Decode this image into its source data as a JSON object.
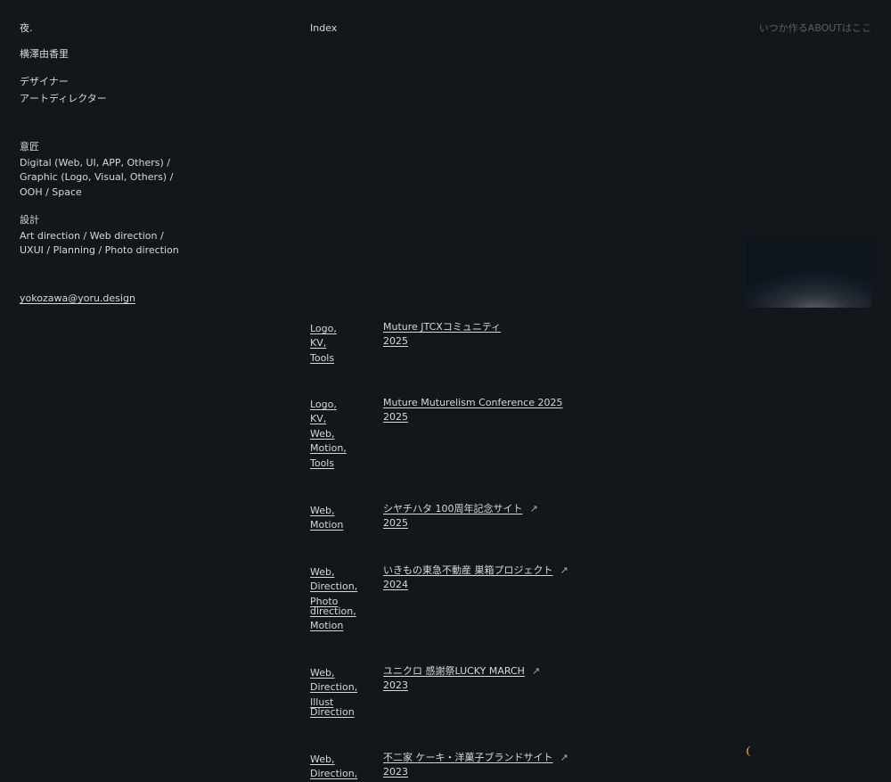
{
  "header": {
    "logo": "夜.",
    "index_label": "Index",
    "about_link": "いつか作るABOUTはここ"
  },
  "profile": {
    "name": "横澤由香里",
    "roles": [
      "デザイナー",
      "アートディレクター"
    ],
    "skills": [
      {
        "title": "意匠",
        "body": [
          "Digital (Web, UI, APP, Others) /",
          "Graphic (Logo, Visual, Others) /",
          "OOH / Space"
        ]
      },
      {
        "title": "設計",
        "body": [
          "Art direction / Web direction /",
          "UXUI / Planning / Photo direction"
        ]
      }
    ],
    "email": "yokozawa@yoru.design"
  },
  "projects": [
    {
      "tags": [
        "Logo,",
        "KV,",
        "Tools"
      ],
      "title": "Muture JTCXコミュニティ",
      "year": "2025",
      "external": false
    },
    {
      "tags": [
        "Logo,",
        "KV,",
        "Web,",
        "Motion,",
        "Tools"
      ],
      "title": "Muture Muturelism Conference 2025",
      "year": "2025",
      "external": false
    },
    {
      "tags": [
        "Web,",
        "Motion"
      ],
      "title": "シヤチハタ 100周年記念サイト",
      "year": "2025",
      "external": true
    },
    {
      "tags": [
        "Web,",
        "Direction,",
        "Photo direction,",
        "Motion"
      ],
      "title": "いきもの東急不動産 巣箱プロジェクト",
      "year": "2024",
      "external": true
    },
    {
      "tags": [
        "Web,",
        "Direction,",
        "Illust Direction"
      ],
      "title": "ユニクロ 感謝祭LUCKY MARCH",
      "year": "2023",
      "external": true
    },
    {
      "tags": [
        "Web,",
        "Direction,"
      ],
      "title": "不二家 ケーキ・洋菓子ブランドサイト",
      "year": "2023",
      "external": true
    }
  ],
  "icons": {
    "external": "↗",
    "theme": "crescent-moon-icon"
  },
  "colors": {
    "background": "#13161a",
    "text": "#d8d8d6",
    "muted": "#5a5d60",
    "moon": "#e9a14a"
  }
}
